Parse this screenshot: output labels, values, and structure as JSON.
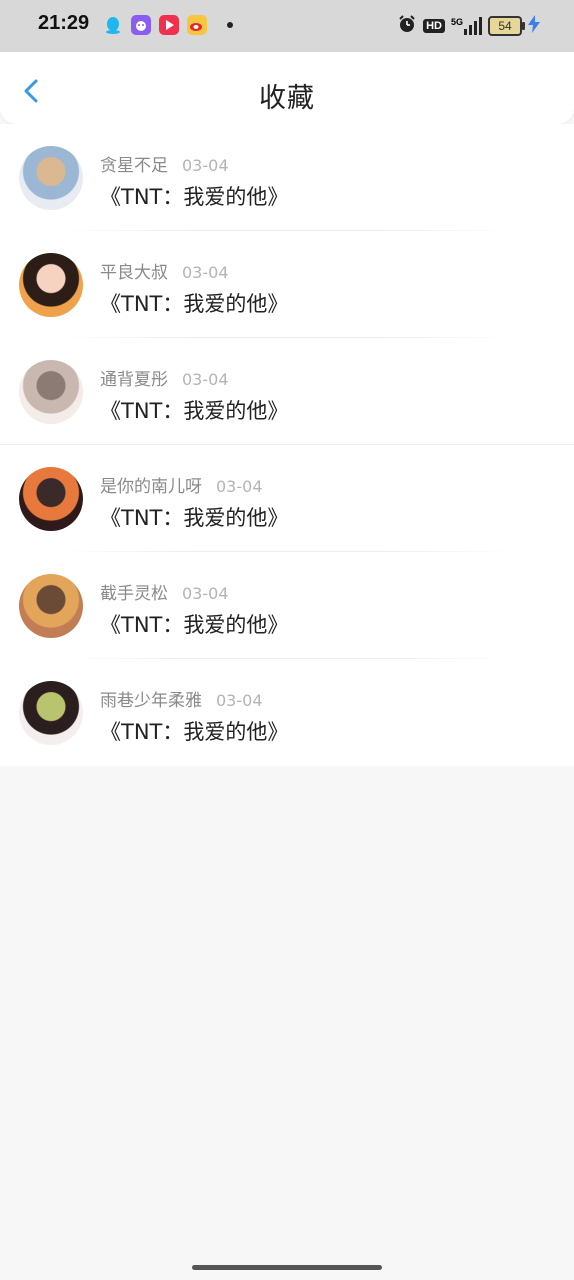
{
  "status_bar": {
    "time": "21:29",
    "battery_level": "54",
    "network": "5G",
    "hd_label": "HD",
    "icons": [
      "qq-icon",
      "game-icon",
      "video-icon",
      "weibo-icon",
      "notification-dot",
      "alarm-icon",
      "hd-icon",
      "signal-icon",
      "battery-icon",
      "charging-icon"
    ]
  },
  "header": {
    "title": "收藏",
    "back_icon": "chevron-left-icon",
    "back_color": "#3a98e8"
  },
  "favorites": [
    {
      "user": "贪星不足",
      "date": "03-04",
      "title": "《TNT：我爱的他》",
      "avatar_colors": [
        "#e8ecf2",
        "#9bb7d4",
        "#d9b892"
      ]
    },
    {
      "user": "平良大叔",
      "date": "03-04",
      "title": "《TNT：我爱的他》",
      "avatar_colors": [
        "#f0a24a",
        "#2d1d17",
        "#f6d2c0"
      ]
    },
    {
      "user": "通背夏彤",
      "date": "03-04",
      "title": "《TNT：我爱的他》",
      "avatar_colors": [
        "#f3ece9",
        "#c9b8b0",
        "#8c7b75"
      ]
    },
    {
      "user": "是你的南儿呀",
      "date": "03-04",
      "title": "《TNT：我爱的他》",
      "avatar_colors": [
        "#2f1a1a",
        "#e8793c",
        "#3a2b2a"
      ]
    },
    {
      "user": "截手灵松",
      "date": "03-04",
      "title": "《TNT：我爱的他》",
      "avatar_colors": [
        "#c27d55",
        "#e2a55a",
        "#6b4a36"
      ]
    },
    {
      "user": "雨巷少年柔雅",
      "date": "03-04",
      "title": "《TNT：我爱的他》",
      "avatar_colors": [
        "#f4eeee",
        "#2a1e1e",
        "#b8c46e"
      ]
    }
  ],
  "colors": {
    "page_bg": "#f8f7f8",
    "username": "#8a8a8a",
    "date": "#b4b4b4",
    "title": "#222222"
  }
}
